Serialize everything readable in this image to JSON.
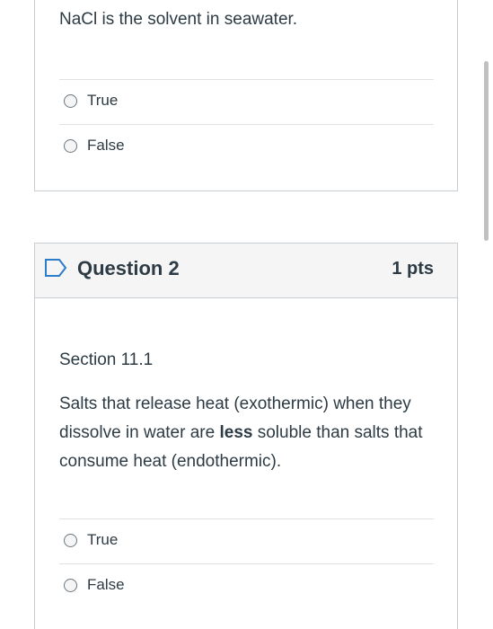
{
  "question1": {
    "text": "NaCl is the solvent in seawater.",
    "answers": [
      {
        "label": "True"
      },
      {
        "label": "False"
      }
    ]
  },
  "question2": {
    "flag_icon": "flag-outline-icon",
    "title": "Question 2",
    "points": "1 pts",
    "section": "Section 11.1",
    "body_before": "Salts that release heat (exothermic) when they dissolve in water are ",
    "body_bold": "less",
    "body_after": " soluble than salts that consume heat (endothermic).",
    "answers": [
      {
        "label": "True"
      },
      {
        "label": "False"
      }
    ]
  },
  "colors": {
    "text": "#2d3b45",
    "border": "#c7cdd1",
    "header_bg": "#f5f5f5",
    "flag": "#2d7cc8"
  }
}
